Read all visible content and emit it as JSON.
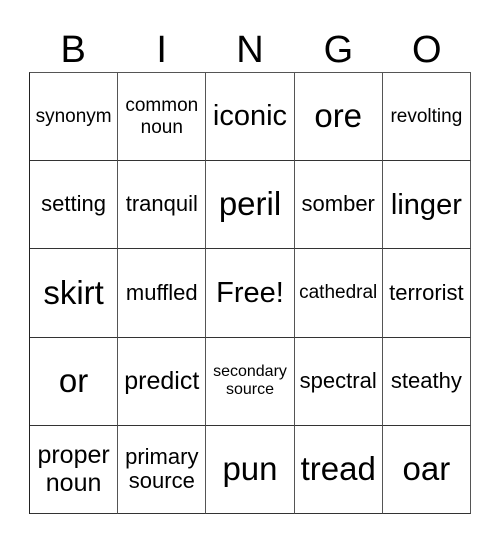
{
  "header": [
    "B",
    "I",
    "N",
    "G",
    "O"
  ],
  "cells": [
    [
      "synonym",
      "common noun",
      "iconic",
      "ore",
      "revolting"
    ],
    [
      "setting",
      "tranquil",
      "peril",
      "somber",
      "linger"
    ],
    [
      "skirt",
      "muffled",
      "Free!",
      "cathedral",
      "terrorist"
    ],
    [
      "or",
      "predict",
      "secondary source",
      "spectral",
      "steathy"
    ],
    [
      "proper noun",
      "primary source",
      "pun",
      "tread",
      "oar"
    ]
  ]
}
